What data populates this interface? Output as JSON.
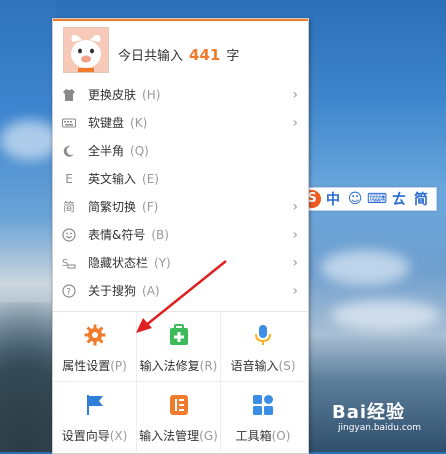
{
  "header": {
    "today_label": "今日共输入",
    "today_count": "441",
    "today_unit": "字"
  },
  "menu_items": [
    {
      "label": "更换皮肤",
      "shortcut": "(H)",
      "arrow": "›",
      "icon": "shirt-icon"
    },
    {
      "label": "软键盘",
      "shortcut": "(K)",
      "arrow": "›",
      "icon": "keyboard-icon"
    },
    {
      "label": "全半角",
      "shortcut": "(Q)",
      "arrow": "",
      "icon": "moon-icon"
    },
    {
      "label": "英文输入",
      "shortcut": "(E)",
      "arrow": "",
      "icon": "letter-e-icon"
    },
    {
      "label": "简繁切换",
      "shortcut": "(F)",
      "arrow": "›",
      "icon": "simplified-char-icon"
    },
    {
      "label": "表情&符号",
      "shortcut": "(B)",
      "arrow": "›",
      "icon": "smiley-icon"
    },
    {
      "label": "隐藏状态栏",
      "shortcut": "(Y)",
      "arrow": "›",
      "icon": "hide-statusbar-icon"
    },
    {
      "label": "关于搜狗",
      "shortcut": "(A)",
      "arrow": "›",
      "icon": "question-icon"
    }
  ],
  "menu_icon_chars": {
    "simplified": "简",
    "letter_e": "E"
  },
  "tiles": [
    {
      "label": "属性设置",
      "shortcut": "(P)",
      "icon": "gear-icon",
      "color": "#f07b2d"
    },
    {
      "label": "输入法修复",
      "shortcut": "(R)",
      "icon": "medkit-icon",
      "color": "#3dbb5b"
    },
    {
      "label": "语音输入",
      "shortcut": "(S)",
      "icon": "microphone-icon",
      "color": "#3a8ee6"
    },
    {
      "label": "设置向导",
      "shortcut": "(X)",
      "icon": "flag-icon",
      "color": "#2f7fd8"
    },
    {
      "label": "输入法管理",
      "shortcut": "(G)",
      "icon": "list-manage-icon",
      "color": "#f07b2d"
    },
    {
      "label": "工具箱",
      "shortcut": "(O)",
      "icon": "grid-tools-icon",
      "color": "#3a8ee6"
    }
  ],
  "statusbar": {
    "logo": "S",
    "lang": "中",
    "smiley": "☺",
    "keyboard": "⌨",
    "punct": "ㄊ",
    "mode": "简"
  },
  "watermark": {
    "brand": "Bai经验",
    "site": "jingyan.baidu.com"
  },
  "colors": {
    "accent": "#f07b2d",
    "annotation_arrow": "#e02020",
    "statusbar_blue": "#2a6bd1"
  }
}
